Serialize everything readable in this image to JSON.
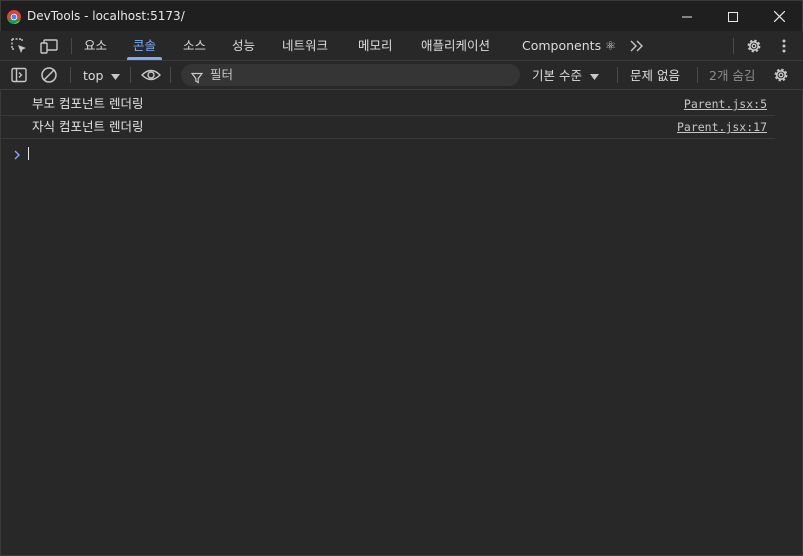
{
  "window": {
    "title": "DevTools - localhost:5173/"
  },
  "tabs": [
    {
      "label": "요소"
    },
    {
      "label": "콘솔",
      "active": true
    },
    {
      "label": "소스"
    },
    {
      "label": "성능"
    },
    {
      "label": "네트워크"
    },
    {
      "label": "메모리"
    },
    {
      "label": "애플리케이션"
    },
    {
      "label": "Components ⚛"
    }
  ],
  "toolbar": {
    "context": "top",
    "filter_placeholder": "필터",
    "log_level": "기본 수준",
    "issues": "문제 없음",
    "hidden_count": "2개 숨김"
  },
  "console": {
    "messages": [
      {
        "text": "부모 컴포넌트 렌더링",
        "source": "Parent.jsx:5"
      },
      {
        "text": "자식 컴포넌트 렌더링",
        "source": "Parent.jsx:17"
      }
    ]
  },
  "colors": {
    "accent": "#7cacf8",
    "background": "#282828",
    "titlebar": "#1f1f1f"
  },
  "icons": [
    "chrome-logo-icon",
    "minimize-icon",
    "maximize-icon",
    "close-icon",
    "inspect-element-icon",
    "device-toolbar-icon",
    "more-tabs-icon",
    "settings-icon",
    "more-options-icon",
    "sidebar-toggle-icon",
    "clear-console-icon",
    "dropdown-arrow-icon",
    "live-expression-eye-icon",
    "filter-icon",
    "console-settings-icon",
    "prompt-chevron-icon"
  ]
}
